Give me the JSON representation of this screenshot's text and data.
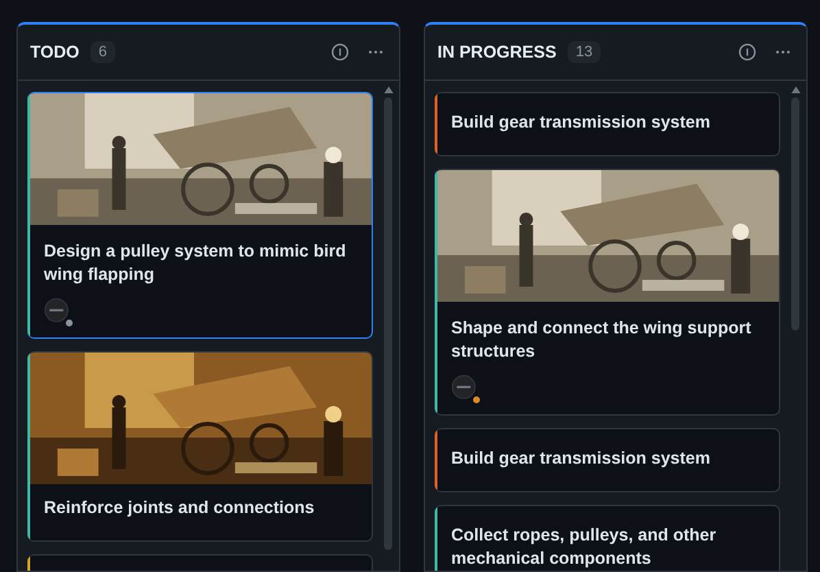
{
  "columns": [
    {
      "title": "TODO",
      "count": "6",
      "cards": [
        {
          "color": "#3fb9a6",
          "selected": true,
          "title": "Design a pulley system to mimic bird wing flapping",
          "avatar": {
            "color": "#8b949e"
          }
        },
        {
          "color": "#3fb9a6",
          "selected": false,
          "title": "Reinforce joints and connections"
        },
        {
          "color": "#d4a72c"
        }
      ]
    },
    {
      "title": "IN PROGRESS",
      "count": "13",
      "cards": [
        {
          "color": "#e0622b",
          "selected": false,
          "title": "Build gear transmission system"
        },
        {
          "color": "#3fb9a6",
          "selected": false,
          "title": "Shape and connect the wing support structures",
          "avatar": {
            "color": "#db8a28"
          }
        },
        {
          "color": "#e0622b",
          "selected": false,
          "title": "Build gear transmission system"
        },
        {
          "color": "#3fb9a6",
          "selected": false,
          "title": "Collect ropes, pulleys, and other mechanical components"
        }
      ]
    }
  ]
}
